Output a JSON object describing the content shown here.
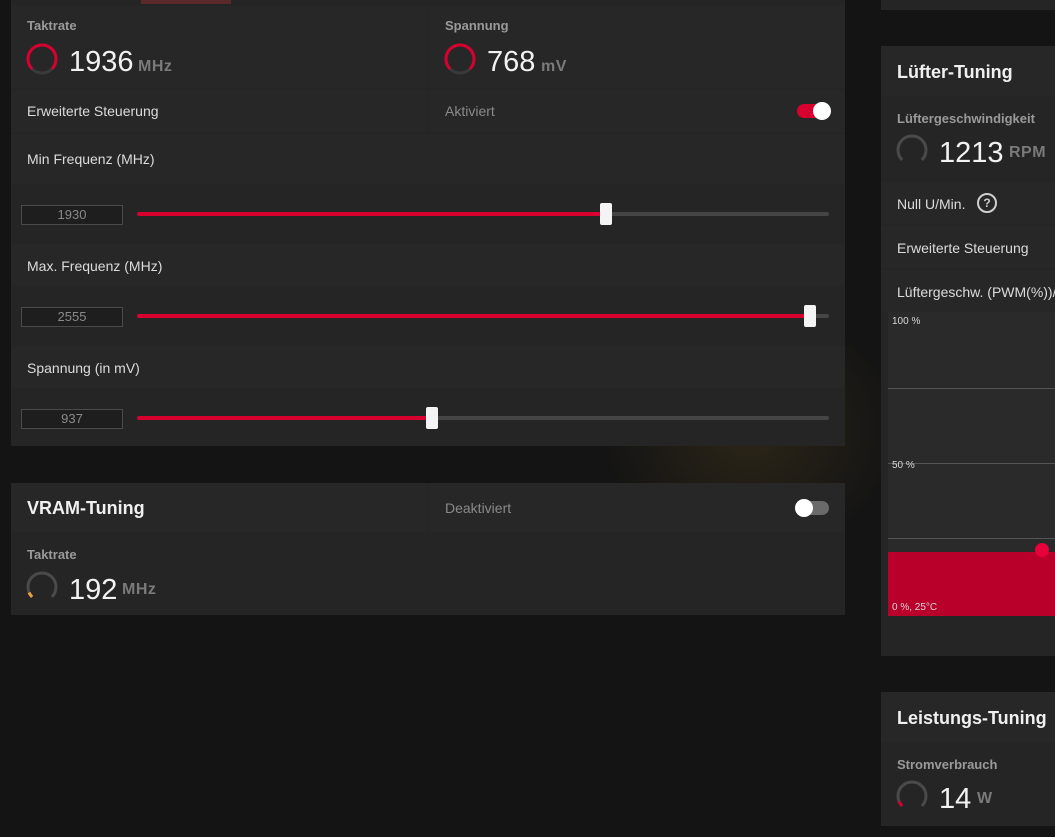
{
  "gpu": {
    "clock": {
      "label": "Taktrate",
      "value": "1936",
      "unit": "MHz"
    },
    "voltage": {
      "label": "Spannung",
      "value": "768",
      "unit": "mV"
    },
    "advanced": {
      "label": "Erweiterte Steuerung",
      "state_label": "Aktiviert",
      "enabled": true
    },
    "min_freq": {
      "label": "Min Frequenz (MHz)",
      "value": "1930",
      "fraction": 0.678
    },
    "max_freq": {
      "label": "Max. Frequenz (MHz)",
      "value": "2555",
      "fraction": 0.973
    },
    "voltage_slider": {
      "label": "Spannung (in mV)",
      "value": "937",
      "fraction": 0.426
    }
  },
  "vram": {
    "title": "VRAM-Tuning",
    "state_label": "Deaktiviert",
    "enabled": false,
    "clock": {
      "label": "Taktrate",
      "value": "192",
      "unit": "MHz"
    }
  },
  "fan": {
    "title": "Lüfter-Tuning",
    "speed": {
      "label": "Lüftergeschwindigkeit",
      "value": "1213",
      "unit": "RPM"
    },
    "zero_rpm_label": "Null U/Min.",
    "help_glyph": "?",
    "advanced_label": "Erweiterte Steuerung",
    "curve_label": "Lüftergeschw. (PWM(%))/T",
    "chart": {
      "y_top_label": "100 %",
      "y_mid_label": "50 %",
      "origin_label": "0 %, 25°C",
      "fill_color": "#b8002a",
      "point_color": "#e8003a"
    }
  },
  "power": {
    "title": "Leistungs-Tuning",
    "consumption": {
      "label": "Stromverbrauch",
      "value": "14",
      "unit": "W"
    }
  },
  "colors": {
    "accent": "#d8002e",
    "panel": "#252525",
    "background": "#141414"
  }
}
